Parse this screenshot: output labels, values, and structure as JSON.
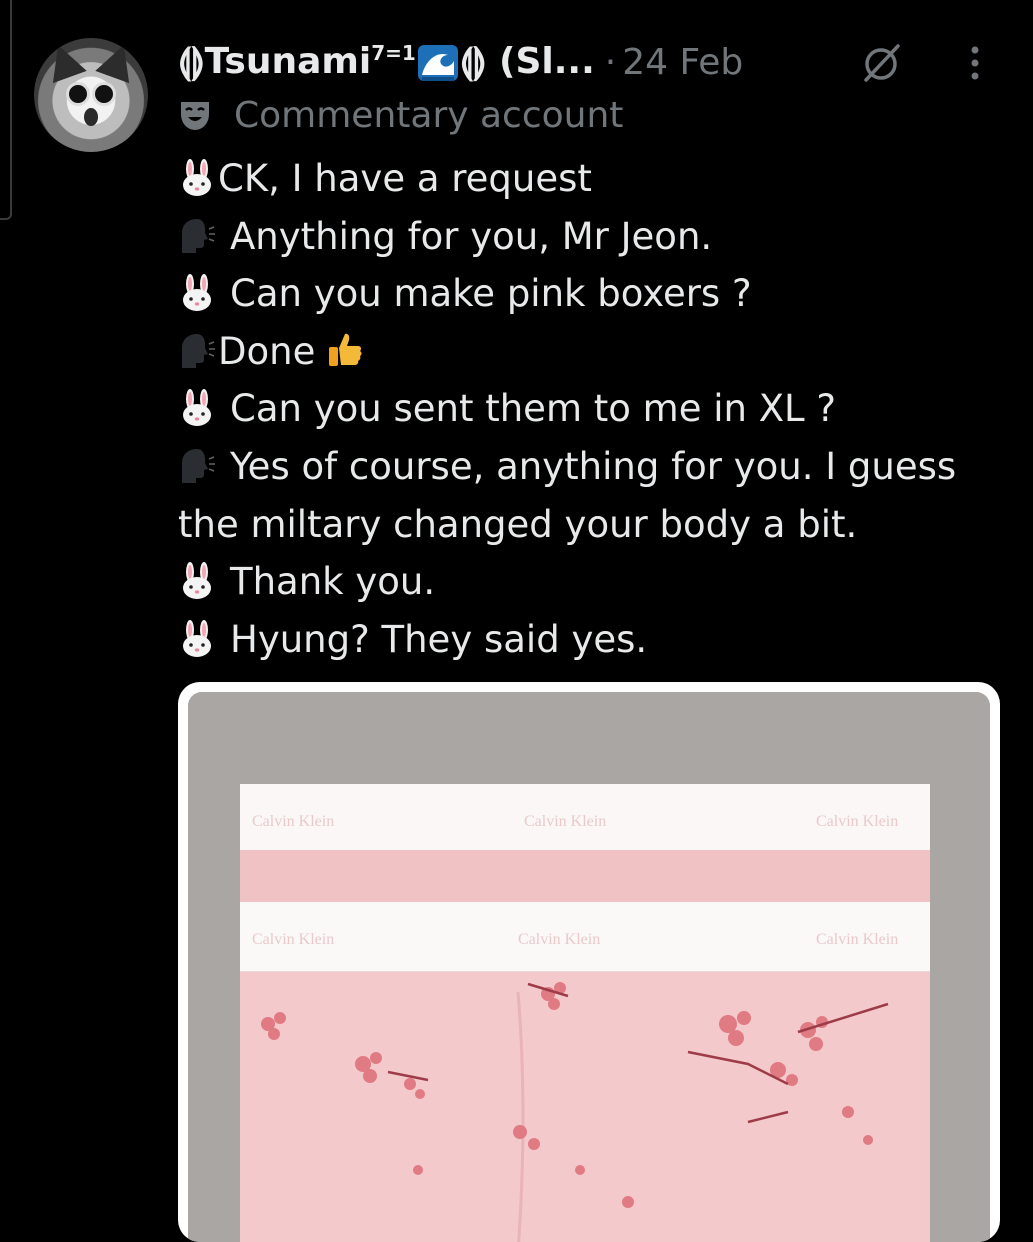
{
  "post": {
    "author": {
      "display_name_prefix": "⟬⟭Tsunami",
      "display_name_sup": "7=1",
      "display_name_suffix": "⟬⟭ (Sl...",
      "avatar_icon": "cat-avatar"
    },
    "separator": "·",
    "date": "24 Feb",
    "label": "Commentary account",
    "label_icon": "theater-mask-icon",
    "lines": [
      {
        "speaker": "rabbit",
        "text": "CK, I have a request"
      },
      {
        "speaker": "speaker-head",
        "text": "Anything for you, Mr Jeon."
      },
      {
        "speaker": "rabbit",
        "text": "Can you make pink boxers ?"
      },
      {
        "speaker": "speaker-head",
        "text": "Done"
      },
      {
        "speaker": "rabbit",
        "text": "Can you sent them to me in XL ?"
      },
      {
        "speaker": "speaker-head",
        "text": "Yes of course, anything for you. I guess the miltary changed your body a bit."
      },
      {
        "speaker": "rabbit",
        "text": "Thank you."
      },
      {
        "speaker": "rabbit",
        "text": "Hyung? They said yes."
      }
    ],
    "media": {
      "brand_text": "Calvin Klein",
      "colors": {
        "backdrop": "#a9a6a3",
        "pink": "#f3c9cb",
        "waistband": "#fbf7f7",
        "blossom": "#e07a83"
      }
    }
  },
  "colors": {
    "background": "#000000",
    "text": "#e7e9ea",
    "muted": "#71767b"
  }
}
